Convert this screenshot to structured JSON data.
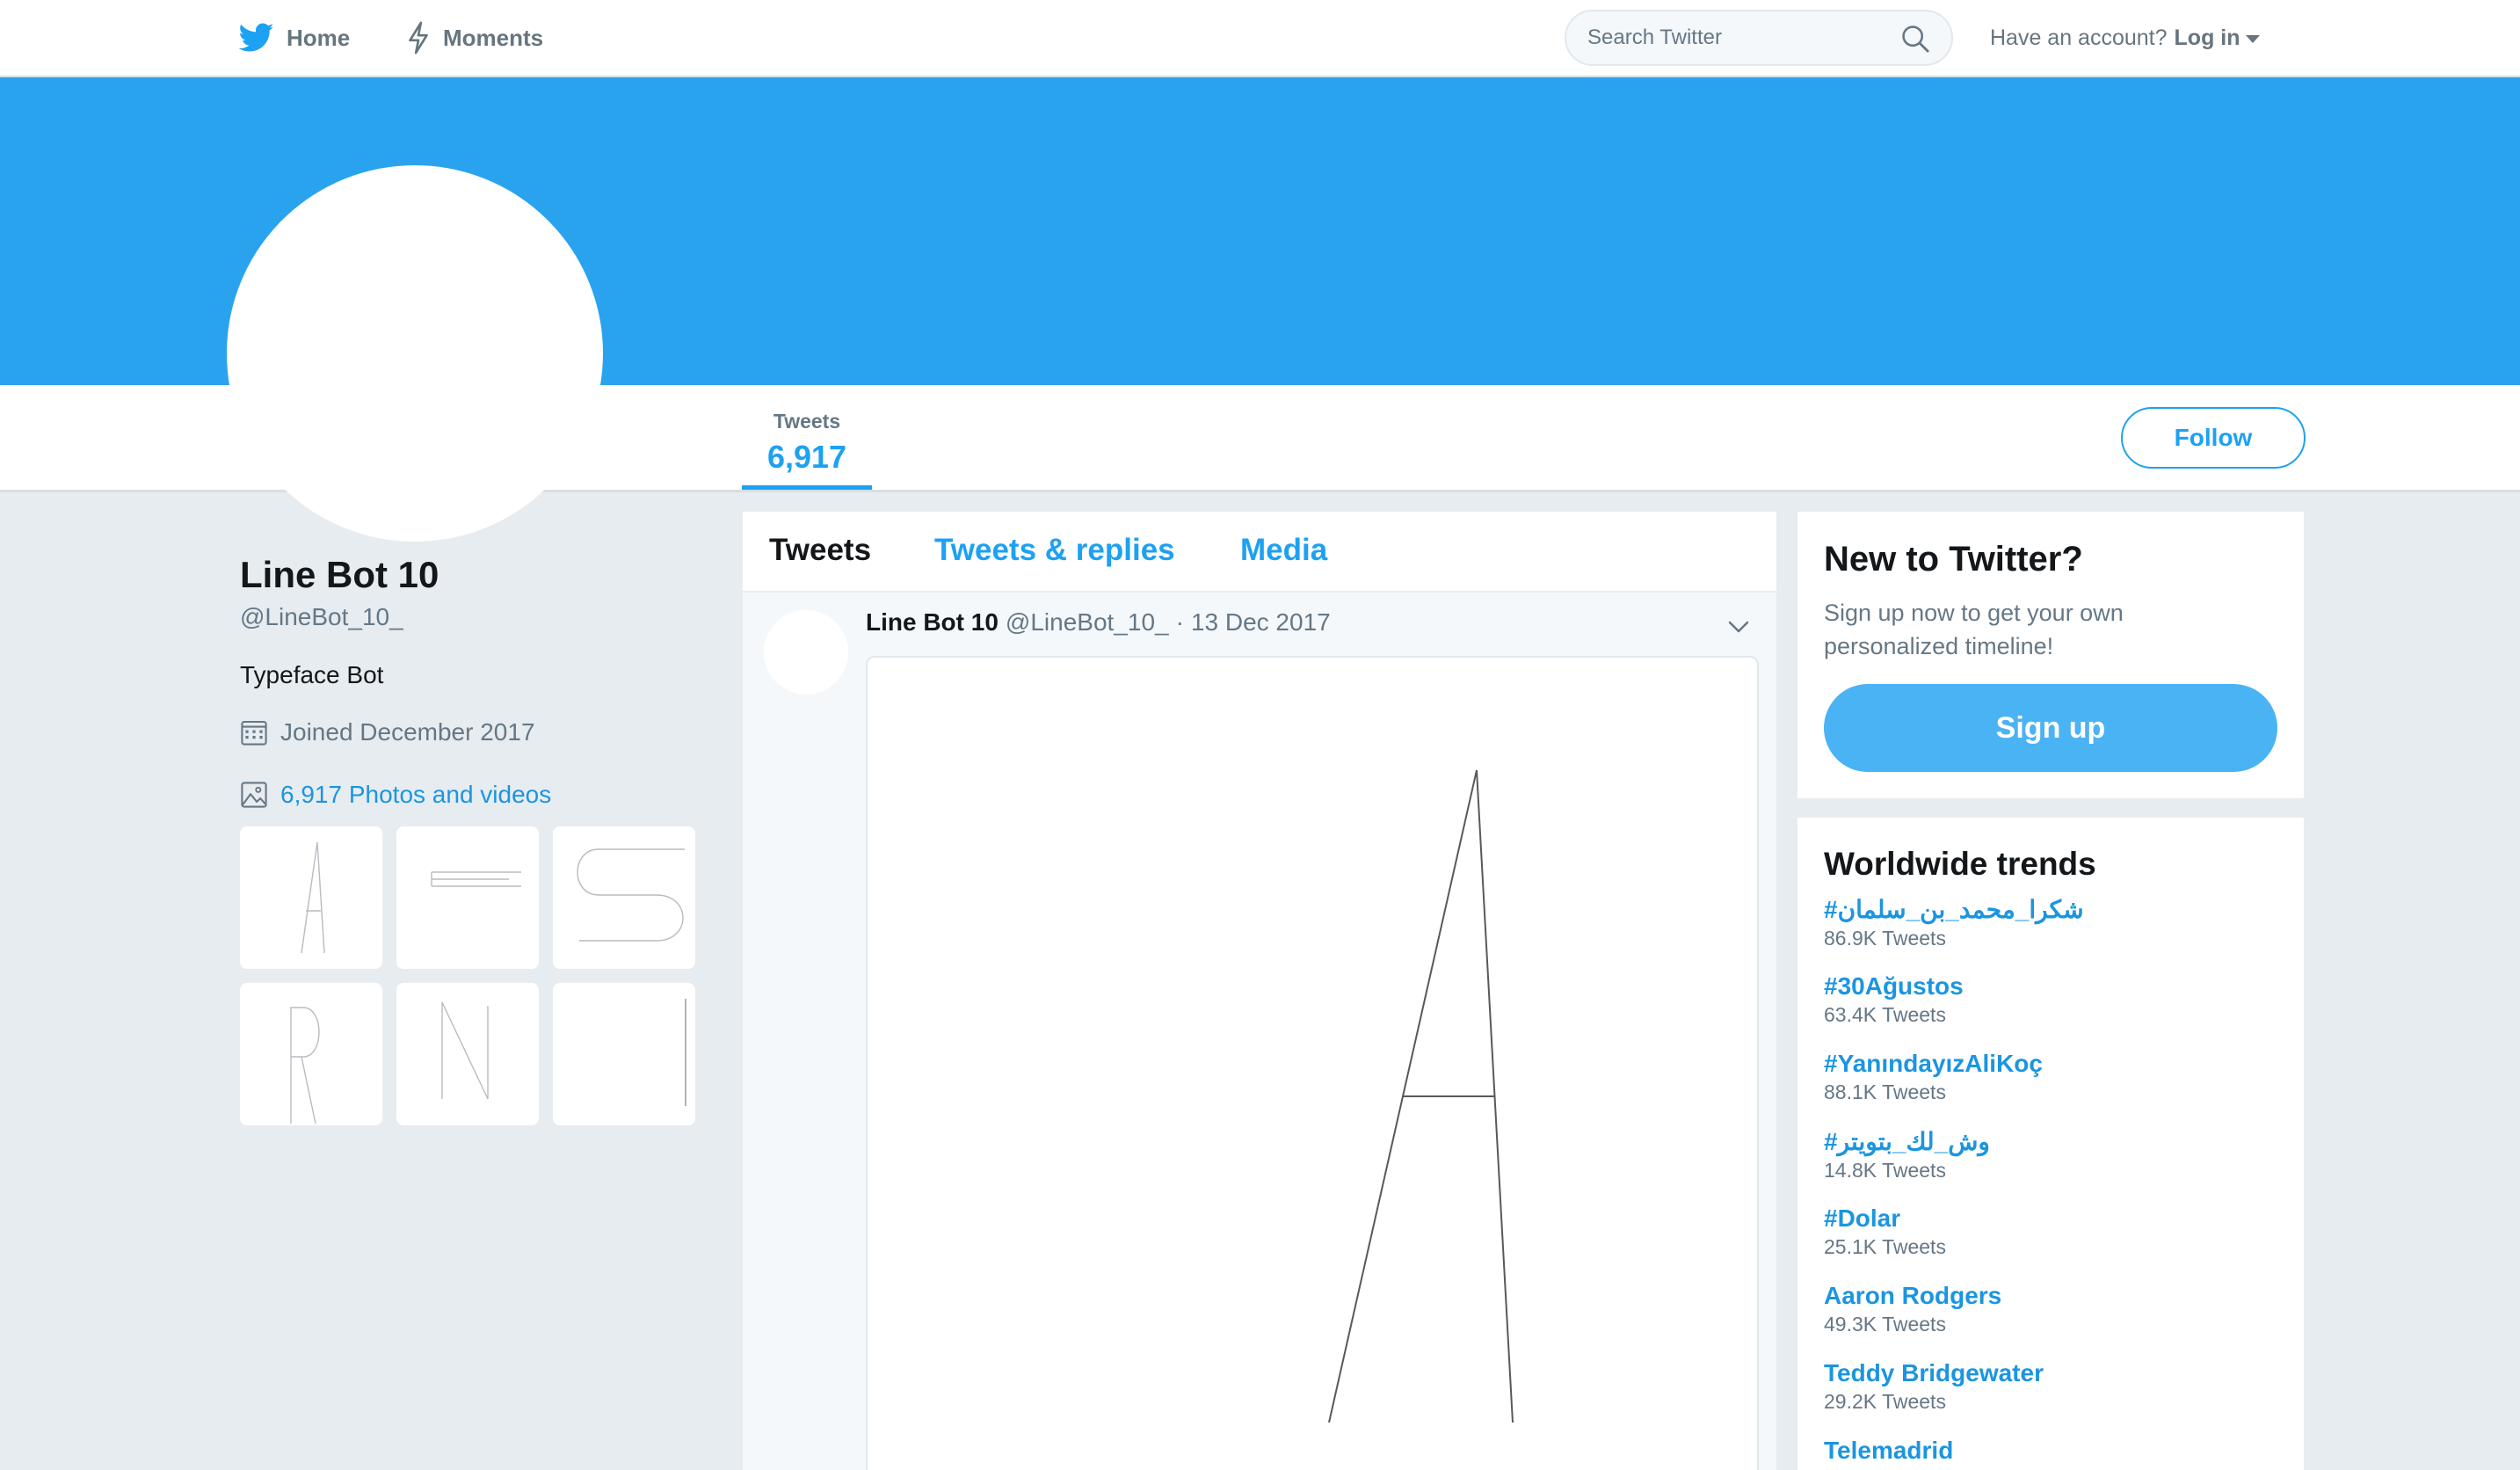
{
  "nav": {
    "home_label": "Home",
    "moments_label": "Moments",
    "search_placeholder": "Search Twitter",
    "account_prompt": "Have an account?",
    "login_label": "Log in"
  },
  "colors": {
    "accent": "#1da1f2",
    "banner": "#2aa3ef",
    "signup_button": "#4ab3f4",
    "page_background": "#e6ecf0"
  },
  "profile": {
    "name": "Line Bot 10",
    "handle": "@LineBot_10_",
    "bio": "Typeface Bot",
    "joined": "Joined December 2017",
    "photos_link": "6,917 Photos and videos",
    "thumbnails": [
      "A",
      "F",
      "S",
      "R",
      "N",
      "I"
    ]
  },
  "stats": {
    "tweets_label": "Tweets",
    "tweets_value": "6,917",
    "follow_label": "Follow"
  },
  "timeline": {
    "tabs": [
      {
        "label": "Tweets",
        "active": true
      },
      {
        "label": "Tweets & replies",
        "active": false
      },
      {
        "label": "Media",
        "active": false
      }
    ],
    "tweet": {
      "name": "Line Bot 10",
      "handle": "@LineBot_10_",
      "separator": "·",
      "date": "13 Dec 2017",
      "media_glyph": "A"
    }
  },
  "sidebar": {
    "new_title": "New to Twitter?",
    "new_subtitle": "Sign up now to get your own personalized timeline!",
    "signup_label": "Sign up",
    "trends_title": "Worldwide trends",
    "trends": [
      {
        "name": "#شكرا_محمد_بن_سلمان",
        "count": "86.9K Tweets"
      },
      {
        "name": "#30Ağustos",
        "count": "63.4K Tweets"
      },
      {
        "name": "#YanındayızAliKoç",
        "count": "88.1K Tweets"
      },
      {
        "name": "#وش_لك_بتويتر",
        "count": "14.8K Tweets"
      },
      {
        "name": "#Dolar",
        "count": "25.1K Tweets"
      },
      {
        "name": "Aaron Rodgers",
        "count": "49.3K Tweets"
      },
      {
        "name": "Teddy Bridgewater",
        "count": "29.2K Tweets"
      },
      {
        "name": "Telemadrid",
        "count": ""
      }
    ]
  },
  "icons": {
    "home": "twitter-bird-icon",
    "moments": "lightning-icon",
    "search": "search-icon",
    "joined": "calendar-icon",
    "photos": "image-icon",
    "tweet_menu": "chevron-down-icon"
  }
}
